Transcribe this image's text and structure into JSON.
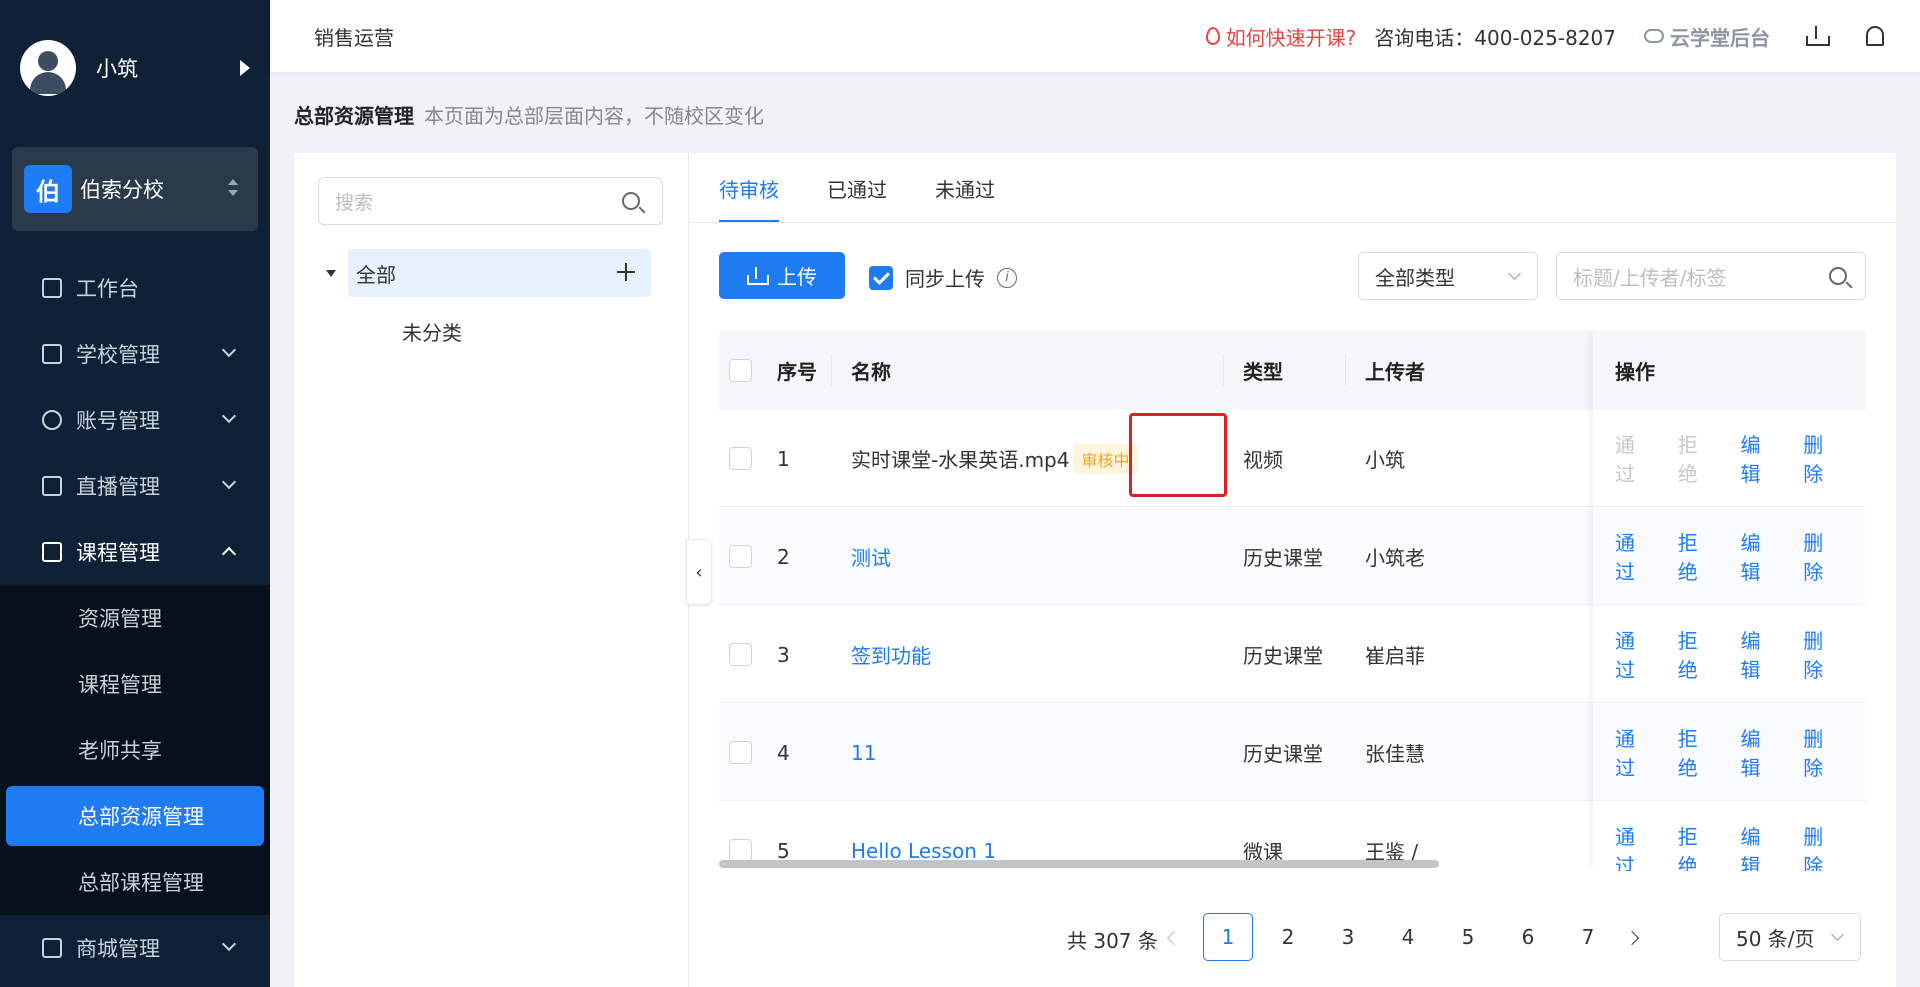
{
  "sidebar": {
    "user_name": "小筑",
    "school_badge": "伯",
    "school_name": "伯索分校",
    "menu": [
      {
        "label": "工作台"
      },
      {
        "label": "学校管理"
      },
      {
        "label": "账号管理"
      },
      {
        "label": "直播管理"
      },
      {
        "label": "课程管理"
      }
    ],
    "submenu": [
      {
        "label": "资源管理"
      },
      {
        "label": "课程管理"
      },
      {
        "label": "老师共享"
      },
      {
        "label": "总部资源管理"
      },
      {
        "label": "总部课程管理"
      }
    ],
    "mall": "商城管理"
  },
  "header": {
    "title": "销售运营",
    "quick_start": "如何快速开课?",
    "phone": "咨询电话：400-025-8207",
    "brand": "云学堂后台"
  },
  "page": {
    "title": "总部资源管理",
    "subtitle": "本页面为总部层面内容，不随校区变化"
  },
  "tree": {
    "search_placeholder": "搜索",
    "all": "全部",
    "uncategorized": "未分类"
  },
  "tabs": [
    "待审核",
    "已通过",
    "未通过"
  ],
  "toolbar": {
    "upload": "上传",
    "sync_upload": "同步上传",
    "info": "i",
    "type_select": "全部类型",
    "filter_placeholder": "标题/上传者/标签"
  },
  "table": {
    "headers": {
      "index": "序号",
      "name": "名称",
      "type": "类型",
      "uploader": "上传者",
      "ops": "操作"
    },
    "rows": [
      {
        "index": "1",
        "name": "实时课堂-水果英语.mp4",
        "tag": "审核中",
        "type": "视频",
        "uploader": "小筑"
      },
      {
        "index": "2",
        "name": "测试",
        "type": "历史课堂",
        "uploader": "小筑老"
      },
      {
        "index": "3",
        "name": "签到功能",
        "type": "历史课堂",
        "uploader": "崔启菲"
      },
      {
        "index": "4",
        "name": "11",
        "type": "历史课堂",
        "uploader": "张佳慧"
      },
      {
        "index": "5",
        "name": "Hello Lesson 1",
        "type": "微课",
        "uploader": "王鉴 /"
      }
    ],
    "ops": {
      "approve": "通过",
      "reject": "拒绝",
      "edit": "编辑",
      "delete": "删除"
    }
  },
  "pagination": {
    "total": "共 307 条",
    "pages": [
      "1",
      "2",
      "3",
      "4",
      "5",
      "6",
      "7"
    ],
    "page_size": "50 条/页"
  },
  "colors": {
    "accent": "#1e7bf2",
    "sidebar": "#0f2136",
    "warning": "#f5a623",
    "danger": "#e84545"
  }
}
